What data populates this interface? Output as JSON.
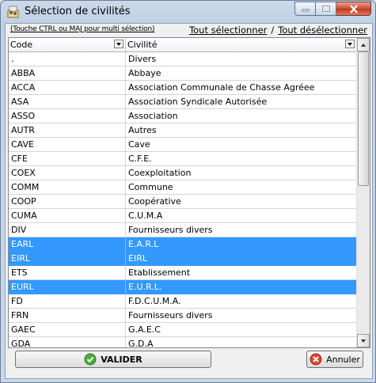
{
  "window": {
    "title": "Sélection de civilités"
  },
  "toolbar": {
    "hint": "(Touche CTRL ou MAJ pour multi sélection)",
    "select_all": "Tout sélectionner",
    "separator": "/",
    "deselect_all": "Tout désélectionner"
  },
  "grid": {
    "columns": [
      "Code",
      "Civilité"
    ],
    "rows": [
      {
        "code": ".",
        "civilite": "Divers",
        "selected": false
      },
      {
        "code": "ABBA",
        "civilite": "Abbaye",
        "selected": false
      },
      {
        "code": "ACCA",
        "civilite": "Association Communale de Chasse Agréee",
        "selected": false
      },
      {
        "code": "ASA",
        "civilite": "Association Syndicale Autorisée",
        "selected": false
      },
      {
        "code": "ASSO",
        "civilite": "Association",
        "selected": false
      },
      {
        "code": "AUTR",
        "civilite": "Autres",
        "selected": false
      },
      {
        "code": "CAVE",
        "civilite": "Cave",
        "selected": false
      },
      {
        "code": "CFE",
        "civilite": "C.F.E.",
        "selected": false
      },
      {
        "code": "COEX",
        "civilite": "Coexploitation",
        "selected": false
      },
      {
        "code": "COMM",
        "civilite": "Commune",
        "selected": false
      },
      {
        "code": "COOP",
        "civilite": "Coopérative",
        "selected": false
      },
      {
        "code": "CUMA",
        "civilite": "C.U.M.A",
        "selected": false
      },
      {
        "code": "DIV",
        "civilite": "Fournisseurs divers",
        "selected": false
      },
      {
        "code": "EARL",
        "civilite": "E.A.R.L",
        "selected": true
      },
      {
        "code": "EIRL",
        "civilite": "EIRL",
        "selected": true
      },
      {
        "code": "ETS",
        "civilite": "Etablissement",
        "selected": false
      },
      {
        "code": "EURL",
        "civilite": "E.U.R.L.",
        "selected": true
      },
      {
        "code": "FD",
        "civilite": "F.D.C.U.M.A.",
        "selected": false
      },
      {
        "code": "FRN",
        "civilite": "Fournisseurs divers",
        "selected": false
      },
      {
        "code": "GAEC",
        "civilite": "G.A.E.C",
        "selected": false
      },
      {
        "code": "GDA",
        "civilite": "G.D.A",
        "selected": false
      }
    ]
  },
  "buttons": {
    "validate": "VALIDER",
    "cancel": "Annuler"
  },
  "colors": {
    "selection": "#3399ff",
    "close_button": "#c94a2e"
  }
}
